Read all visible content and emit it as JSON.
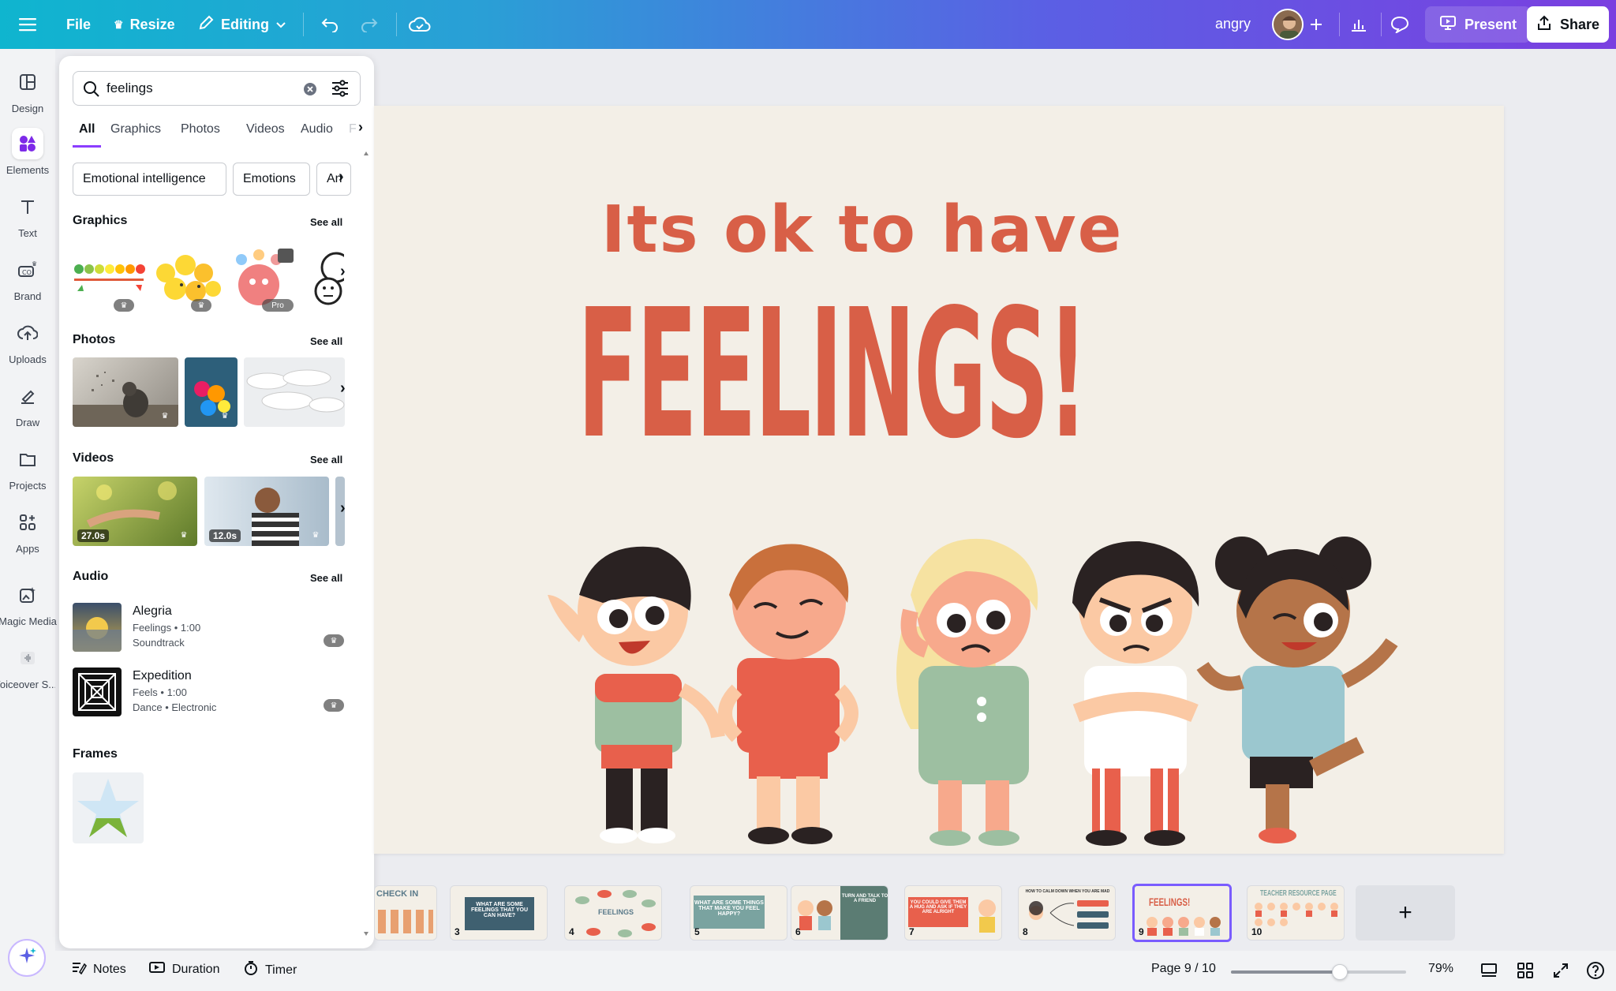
{
  "topbar": {
    "file_label": "File",
    "resize_label": "Resize",
    "editing_label": "Editing",
    "doc_title": "angry",
    "present_label": "Present",
    "share_label": "Share"
  },
  "rail": {
    "items": [
      {
        "label": "Design"
      },
      {
        "label": "Elements"
      },
      {
        "label": "Text"
      },
      {
        "label": "Brand"
      },
      {
        "label": "Uploads"
      },
      {
        "label": "Draw"
      },
      {
        "label": "Projects"
      },
      {
        "label": "Apps"
      },
      {
        "label": "Magic Media"
      },
      {
        "label": "Voiceover S..."
      }
    ]
  },
  "panel": {
    "search_value": "feelings",
    "tabs": [
      "All",
      "Graphics",
      "Photos",
      "Videos",
      "Audio",
      "F"
    ],
    "chips": [
      "Emotional intelligence",
      "Emotions",
      "An"
    ],
    "sections": {
      "graphics": "Graphics",
      "photos": "Photos",
      "videos": "Videos",
      "audio": "Audio",
      "frames": "Frames"
    },
    "see_all": "See all",
    "pro_label": "Pro",
    "videos": [
      {
        "duration": "27.0s"
      },
      {
        "duration": "12.0s"
      }
    ],
    "audio": [
      {
        "title": "Alegria",
        "meta": "Feelings • 1:00",
        "genre": "Soundtrack"
      },
      {
        "title": "Expedition",
        "meta": "Feels • 1:00",
        "genre": "Dance • Electronic"
      }
    ]
  },
  "canvas": {
    "line1": "Its ok to have",
    "line2": "FEELINGS!",
    "accent": "#d85f47",
    "background": "#f3efe7"
  },
  "filmstrip": {
    "slides": [
      {
        "num": "",
        "caption": "CHECK IN"
      },
      {
        "num": "3",
        "caption": "WHAT ARE SOME FEELINGS THAT YOU CAN HAVE?"
      },
      {
        "num": "4",
        "caption": "FEELINGS"
      },
      {
        "num": "5",
        "caption": "WHAT ARE SOME THINGS THAT MAKE YOU FEEL HAPPY?"
      },
      {
        "num": "6",
        "caption": "TURN AND TALK TO A FRIEND"
      },
      {
        "num": "7",
        "caption": "YOU COULD GIVE THEM A HUG AND ASK IF THEY ARE ALRIGHT"
      },
      {
        "num": "8",
        "caption": "HOW TO CALM DOWN WHEN YOU ARE MAD"
      },
      {
        "num": "9",
        "caption": "FEELINGS!"
      },
      {
        "num": "10",
        "caption": "TEACHER RESOURCE PAGE"
      }
    ],
    "add_label": "+"
  },
  "bottombar": {
    "notes_label": "Notes",
    "duration_label": "Duration",
    "timer_label": "Timer",
    "page_indicator": "Page 9 / 10",
    "zoom_label": "79%",
    "zoom_fraction": 0.62
  }
}
